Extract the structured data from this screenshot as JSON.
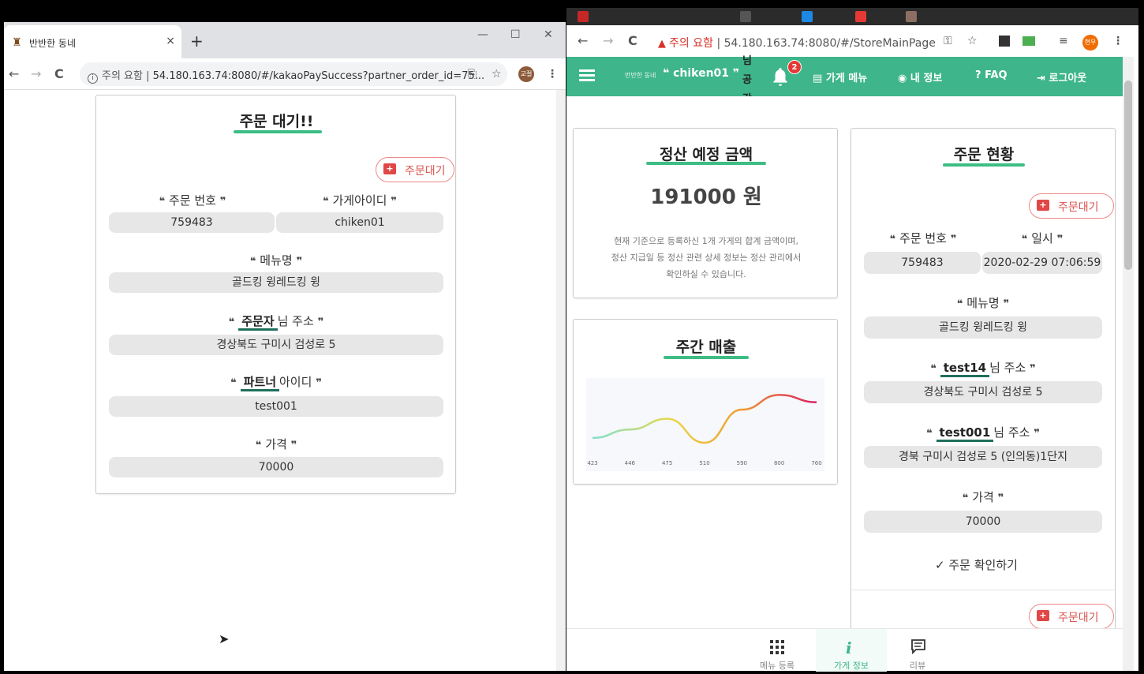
{
  "left_window": {
    "tab_title": "반반한 동네",
    "tab_close": "×",
    "new_tab": "+",
    "win_min": "—",
    "win_max": "☐",
    "win_close": "✕",
    "nav_back": "←",
    "nav_forward": "→",
    "nav_reload": "C",
    "address_prefix": "주의 요함 |",
    "address_url": "54.180.163.74:8080/#/kakaoPaySuccess?partner_order_id=75...",
    "profile_label": "교절",
    "card": {
      "title": "주문 대기!!",
      "status_button": "주문대기",
      "fields": {
        "order_no_label": "주문 번호",
        "store_id_label": "가게아이디",
        "menu_label": "메뉴명",
        "orderer_name": "주문자",
        "orderer_suffix": "님 주소",
        "partner_name": "파트너",
        "partner_suffix": "아이디",
        "price_label": "가격"
      },
      "values": {
        "order_no": "759483",
        "store_id": "chiken01",
        "menu": "골드킹 윙레드킹 윙",
        "address": "경상북도 구미시 검성로 5",
        "partner_id": "test001",
        "price": "70000"
      }
    }
  },
  "right_window": {
    "nav_back": "←",
    "nav_forward": "→",
    "nav_reload": "C",
    "address_warning": "주의 요함",
    "address_url": "| 54.180.163.74:8080/#/StoreMainPage",
    "profile_label": "현우",
    "appbar": {
      "brand_small": "반반한 동네",
      "brand_name": "chiken01",
      "vertical_text": "님 공 간",
      "notification_count": "2",
      "nav": {
        "store_menu": "가게 메뉴",
        "my_info": "내 정보",
        "faq": "FAQ",
        "logout": "로그아웃"
      }
    },
    "settlement": {
      "title": "정산 예정 금액",
      "amount": "191000 원",
      "description_lines": [
        "현재 기준으로 등록하신 1개 가게의 합계 금액이며,",
        "정산 지급일 등 정산 관련 상세 정보는 정산 관리에서",
        "확인하실 수 있습니다."
      ]
    },
    "weekly_sales": {
      "title": "주간 매출"
    },
    "order_status": {
      "title": "주문 현황",
      "status_button": "주문대기",
      "labels": {
        "order_no": "주문 번호",
        "datetime": "일시",
        "menu": "메뉴명",
        "orderer_name": "test14",
        "orderer_suffix": "님 주소",
        "partner_name": "test001",
        "partner_suffix": "님 주소",
        "price": "가격"
      },
      "values": {
        "order_no": "759483",
        "datetime": "2020-02-29 07:06:59",
        "menu": "골드킹 윙레드킹 윙",
        "orderer_address": "경상북도 구미시 검성로 5",
        "partner_address": "경북 구미시 검성로 5 (인의동)1단지",
        "price": "70000"
      },
      "confirm": "주문 확인하기",
      "status_button_2": "주문대기"
    },
    "bottom_nav": {
      "menu_register": "메뉴 등록",
      "store_info": "가게 정보",
      "review": "리뷰"
    }
  },
  "chart_data": {
    "type": "line",
    "categories": [
      "423",
      "446",
      "475",
      "510",
      "590",
      "800",
      "760"
    ],
    "values": [
      423,
      446,
      475,
      410,
      500,
      540,
      520
    ],
    "ylim": [
      380,
      560
    ],
    "grid": false,
    "colors": [
      "#7fe0d0",
      "#e8d84a",
      "#f0a030",
      "#d81b60"
    ]
  },
  "quote_open": "❝",
  "quote_close": "❞"
}
